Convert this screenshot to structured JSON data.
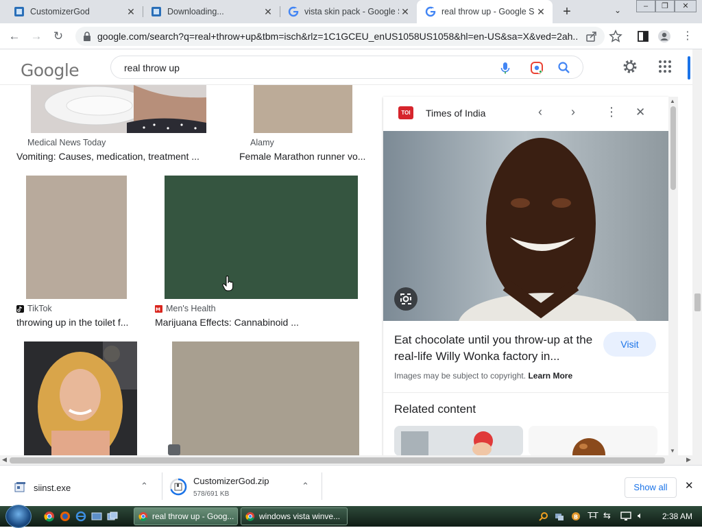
{
  "browser": {
    "tabs": [
      {
        "title": "CustomizerGod",
        "favicon": "customizergod-icon"
      },
      {
        "title": "Downloading...",
        "favicon": "customizergod-icon"
      },
      {
        "title": "vista skin pack - Google S",
        "favicon": "google-g-icon"
      },
      {
        "title": "real throw up - Google Se",
        "favicon": "google-g-icon",
        "active": true
      }
    ],
    "url": "google.com/search?q=real+throw+up&tbm=isch&rlz=1C1GCEU_enUS1058US1058&hl=en-US&sa=X&ved=2ah..."
  },
  "google": {
    "logo": "Google",
    "query": "real throw up"
  },
  "results": [
    {
      "source": "Medical News Today",
      "caption": "Vomiting: Causes, medication, treatment ..."
    },
    {
      "source": "Alamy",
      "caption": "Female Marathon runner vo..."
    },
    {
      "source": "TikTok",
      "caption": "throwing up in the toilet f..."
    },
    {
      "source": "Men's Health",
      "caption": "Marijuana Effects: Cannabinoid ..."
    }
  ],
  "panel": {
    "source": "Times of India",
    "source_badge": "TOI",
    "title": "Eat chocolate until you throw-up at the real-life Willy Wonka factory in...",
    "visit_label": "Visit",
    "copyright": "Images may be subject to copyright.",
    "learn_more": "Learn More",
    "related_heading": "Related content"
  },
  "downloads": [
    {
      "name": "siinst.exe",
      "detail": ""
    },
    {
      "name": "CustomizerGod.zip",
      "detail": "578/691 KB"
    }
  ],
  "shelf": {
    "show_all": "Show all"
  },
  "taskbar": {
    "tasks": [
      {
        "label": "real throw up - Goog...",
        "active": true
      },
      {
        "label": "windows vista winve...",
        "active": false
      }
    ],
    "clock": "2:38 AM"
  },
  "colors": {
    "accent": "#1a73e8",
    "swatch_green": "#355540",
    "swatch_beige": "#b8aa9c",
    "swatch_khaki": "#a89f90"
  }
}
